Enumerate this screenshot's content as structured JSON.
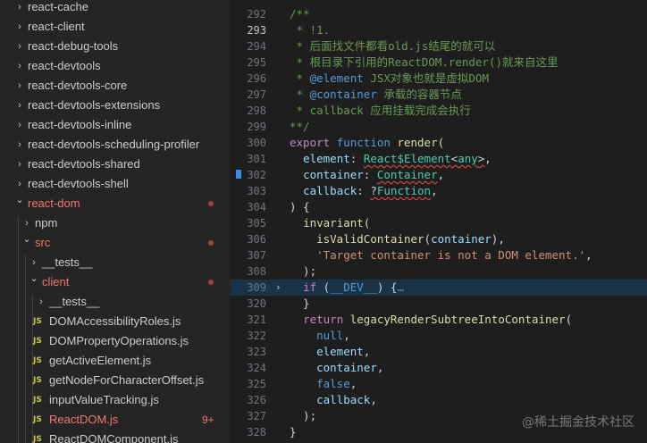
{
  "explorer": {
    "items": [
      {
        "label": "react-cache",
        "kind": "folder",
        "expanded": false,
        "level": 0
      },
      {
        "label": "react-client",
        "kind": "folder",
        "expanded": false,
        "level": 0
      },
      {
        "label": "react-debug-tools",
        "kind": "folder",
        "expanded": false,
        "level": 0
      },
      {
        "label": "react-devtools",
        "kind": "folder",
        "expanded": false,
        "level": 0
      },
      {
        "label": "react-devtools-core",
        "kind": "folder",
        "expanded": false,
        "level": 0
      },
      {
        "label": "react-devtools-extensions",
        "kind": "folder",
        "expanded": false,
        "level": 0
      },
      {
        "label": "react-devtools-inline",
        "kind": "folder",
        "expanded": false,
        "level": 0
      },
      {
        "label": "react-devtools-scheduling-profiler",
        "kind": "folder",
        "expanded": false,
        "level": 0
      },
      {
        "label": "react-devtools-shared",
        "kind": "folder",
        "expanded": false,
        "level": 0
      },
      {
        "label": "react-devtools-shell",
        "kind": "folder",
        "expanded": false,
        "level": 0
      },
      {
        "label": "react-dom",
        "kind": "folder",
        "expanded": true,
        "level": 0,
        "status": "modified"
      },
      {
        "label": "npm",
        "kind": "folder",
        "expanded": false,
        "level": 1
      },
      {
        "label": "src",
        "kind": "folder",
        "expanded": true,
        "level": 1,
        "status": "modified"
      },
      {
        "label": "__tests__",
        "kind": "folder",
        "expanded": false,
        "level": 2
      },
      {
        "label": "client",
        "kind": "folder",
        "expanded": true,
        "level": 2,
        "status": "modified"
      },
      {
        "label": "__tests__",
        "kind": "folder",
        "expanded": false,
        "level": 3
      },
      {
        "label": "DOMAccessibilityRoles.js",
        "kind": "file",
        "level": 3
      },
      {
        "label": "DOMPropertyOperations.js",
        "kind": "file",
        "level": 3
      },
      {
        "label": "getActiveElement.js",
        "kind": "file",
        "level": 3
      },
      {
        "label": "getNodeForCharacterOffset.js",
        "kind": "file",
        "level": 3
      },
      {
        "label": "inputValueTracking.js",
        "kind": "file",
        "level": 3
      },
      {
        "label": "ReactDOM.js",
        "kind": "file",
        "level": 3,
        "status": "error",
        "badge": "9+"
      },
      {
        "label": "ReactDOMComponent.js",
        "kind": "file",
        "level": 3
      }
    ]
  },
  "editor": {
    "active_line": "293",
    "lines": [
      {
        "n": "292",
        "tokens": [
          [
            "cmt",
            "/**"
          ]
        ]
      },
      {
        "n": "293",
        "tokens": [
          [
            "cmt",
            " * !1."
          ]
        ]
      },
      {
        "n": "294",
        "tokens": [
          [
            "cmt",
            " * 后面找文件都看old.js结尾的就可以"
          ]
        ]
      },
      {
        "n": "295",
        "tokens": [
          [
            "cmt",
            " * 根目录下引用的ReactDOM.render()就来自这里"
          ]
        ]
      },
      {
        "n": "296",
        "tokens": [
          [
            "cmt",
            " * "
          ],
          [
            "kw",
            "@element"
          ],
          [
            "cmt",
            " JSX对象也就是虚拟DOM"
          ]
        ]
      },
      {
        "n": "297",
        "tokens": [
          [
            "cmt",
            " * "
          ],
          [
            "kw",
            "@container"
          ],
          [
            "cmt",
            " 承载的容器节点"
          ]
        ]
      },
      {
        "n": "298",
        "tokens": [
          [
            "cmt",
            " * callback 应用挂载完成会执行"
          ]
        ]
      },
      {
        "n": "299",
        "tokens": [
          [
            "cmt",
            "**/"
          ]
        ]
      },
      {
        "n": "300",
        "tokens": [
          [
            "ctl",
            "export"
          ],
          [
            "pun",
            " "
          ],
          [
            "kw",
            "function"
          ],
          [
            "pun",
            " "
          ],
          [
            "fn",
            "render"
          ],
          [
            "pun",
            "("
          ]
        ]
      },
      {
        "n": "301",
        "tokens": [
          [
            "pun",
            "  "
          ],
          [
            "prm",
            "element"
          ],
          [
            "pun",
            ": "
          ],
          [
            "ty sq",
            "React$Element"
          ],
          [
            "pun sq",
            "<"
          ],
          [
            "ty sq",
            "any"
          ],
          [
            "pun sq",
            ">"
          ],
          [
            "pun",
            ","
          ]
        ]
      },
      {
        "n": "302",
        "tokens": [
          [
            "pun",
            "  "
          ],
          [
            "prm",
            "container"
          ],
          [
            "pun",
            ": "
          ],
          [
            "ty sq",
            "Container"
          ],
          [
            "pun",
            ","
          ]
        ],
        "bookmark": true
      },
      {
        "n": "303",
        "tokens": [
          [
            "pun",
            "  "
          ],
          [
            "prm",
            "callback"
          ],
          [
            "pun",
            ": "
          ],
          [
            "pun sq",
            "?"
          ],
          [
            "ty sq",
            "Function"
          ],
          [
            "pun",
            ","
          ]
        ]
      },
      {
        "n": "304",
        "tokens": [
          [
            "pun",
            ") {"
          ]
        ]
      },
      {
        "n": "305",
        "tokens": [
          [
            "pun",
            "  "
          ],
          [
            "fn",
            "invariant"
          ],
          [
            "pun",
            "("
          ]
        ]
      },
      {
        "n": "306",
        "tokens": [
          [
            "pun",
            "    "
          ],
          [
            "fn",
            "isValidContainer"
          ],
          [
            "pun",
            "("
          ],
          [
            "prm",
            "container"
          ],
          [
            "pun",
            "),"
          ]
        ]
      },
      {
        "n": "307",
        "tokens": [
          [
            "pun",
            "    "
          ],
          [
            "str",
            "'Target container is not a DOM element.'"
          ],
          [
            "pun",
            ","
          ]
        ]
      },
      {
        "n": "308",
        "tokens": [
          [
            "pun",
            "  );"
          ]
        ]
      },
      {
        "n": "309",
        "tokens": [
          [
            "pun",
            "  "
          ],
          [
            "ctl",
            "if"
          ],
          [
            "pun",
            " ("
          ],
          [
            "kw",
            "__DEV__"
          ],
          [
            "pun",
            ") {"
          ],
          [
            "ellipsis",
            "…"
          ]
        ],
        "folded": true,
        "highlight": true
      },
      {
        "n": "320",
        "tokens": [
          [
            "pun",
            "  }"
          ]
        ]
      },
      {
        "n": "321",
        "tokens": [
          [
            "pun",
            "  "
          ],
          [
            "ctl",
            "return"
          ],
          [
            "pun",
            " "
          ],
          [
            "fn",
            "legacyRenderSubtreeIntoContainer"
          ],
          [
            "pun",
            "("
          ]
        ]
      },
      {
        "n": "322",
        "tokens": [
          [
            "pun",
            "    "
          ],
          [
            "kw",
            "null"
          ],
          [
            "pun",
            ","
          ]
        ]
      },
      {
        "n": "323",
        "tokens": [
          [
            "pun",
            "    "
          ],
          [
            "prm",
            "element"
          ],
          [
            "pun",
            ","
          ]
        ]
      },
      {
        "n": "324",
        "tokens": [
          [
            "pun",
            "    "
          ],
          [
            "prm",
            "container"
          ],
          [
            "pun",
            ","
          ]
        ]
      },
      {
        "n": "325",
        "tokens": [
          [
            "pun",
            "    "
          ],
          [
            "kw",
            "false"
          ],
          [
            "pun",
            ","
          ]
        ]
      },
      {
        "n": "326",
        "tokens": [
          [
            "pun",
            "    "
          ],
          [
            "prm",
            "callback"
          ],
          [
            "pun",
            ","
          ]
        ]
      },
      {
        "n": "327",
        "tokens": [
          [
            "pun",
            "  );"
          ]
        ]
      },
      {
        "n": "328",
        "tokens": [
          [
            "pun",
            "}"
          ]
        ]
      }
    ]
  },
  "watermark": "@稀土掘金技术社区",
  "icons": {
    "collapsed": "chevron-right-icon",
    "expanded": "chevron-down-icon",
    "file": "js-file-icon",
    "fold": "fold-chevron-icon",
    "bookmark": "bookmark-icon"
  },
  "colors": {
    "sidebar_bg": "#252526",
    "editor_bg": "#1e1e1e",
    "error": "#f2776c",
    "comment": "#6a9955",
    "keyword": "#569cd6"
  }
}
